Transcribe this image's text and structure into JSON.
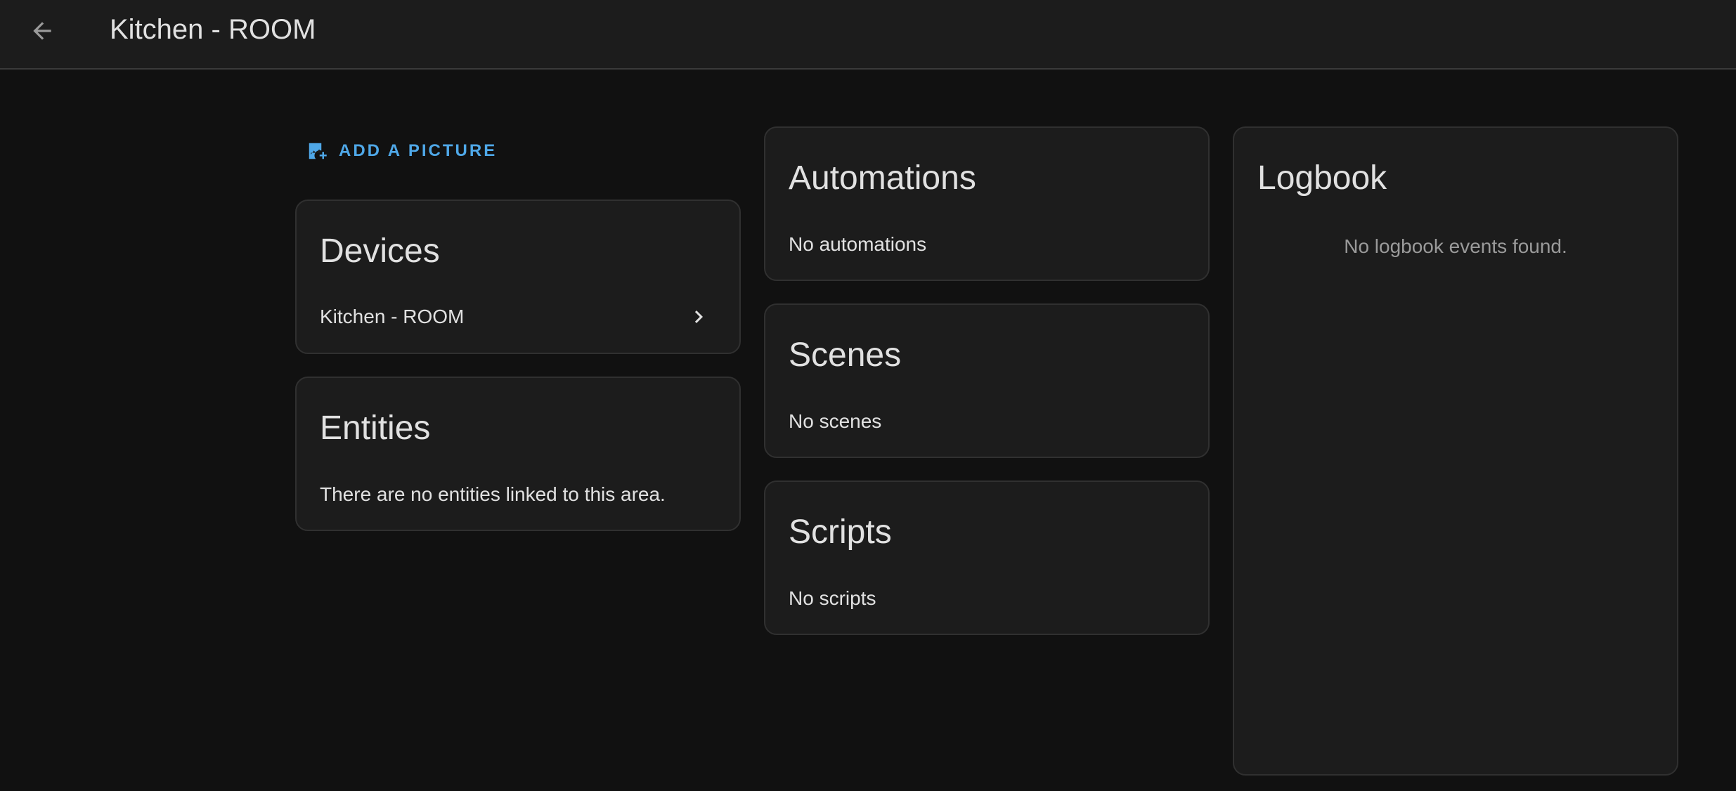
{
  "header": {
    "title": "Kitchen - ROOM",
    "back_icon": "arrow-left-icon"
  },
  "picture": {
    "add_label": "ADD A PICTURE",
    "icon": "image-plus-icon",
    "accent_color": "#4fa8e8"
  },
  "devices": {
    "title": "Devices",
    "items": [
      {
        "label": "Kitchen - ROOM",
        "icon": "chevron-right-icon"
      }
    ]
  },
  "entities": {
    "title": "Entities",
    "empty_text": "There are no entities linked to this area."
  },
  "automations": {
    "title": "Automations",
    "empty_text": "No automations"
  },
  "scenes": {
    "title": "Scenes",
    "empty_text": "No scenes"
  },
  "scripts": {
    "title": "Scripts",
    "empty_text": "No scripts"
  },
  "logbook": {
    "title": "Logbook",
    "empty_text": "No logbook events found."
  }
}
